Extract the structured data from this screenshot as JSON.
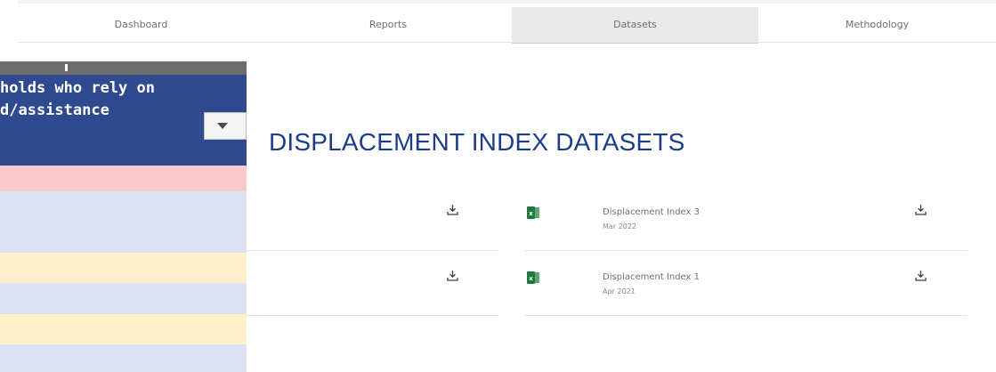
{
  "nav": {
    "tabs": [
      {
        "label": "Dashboard"
      },
      {
        "label": "Reports"
      },
      {
        "label": "Datasets",
        "active": true
      },
      {
        "label": "Methodology"
      }
    ]
  },
  "sheet": {
    "header_text": "holds who rely on\nd/assistance",
    "row_colors": [
      "#fcc8cf",
      "#dde1f4",
      "#fff0ca",
      "#dde1f4",
      "#fff0ca",
      "#dde1f4"
    ]
  },
  "page": {
    "title": "DISPLACEMENT INDEX DATASETS"
  },
  "datasets": [
    {
      "name": "Displacement Index 3",
      "date": "Mar 2022",
      "icon": "excel-icon"
    },
    {
      "name": "Displacement Index 1",
      "date": "Apr 2021",
      "icon": "excel-icon"
    }
  ],
  "colors": {
    "title": "#1d3d8c",
    "sheet_header": "#2f4a8e",
    "excel_green": "#1f7a3f"
  }
}
